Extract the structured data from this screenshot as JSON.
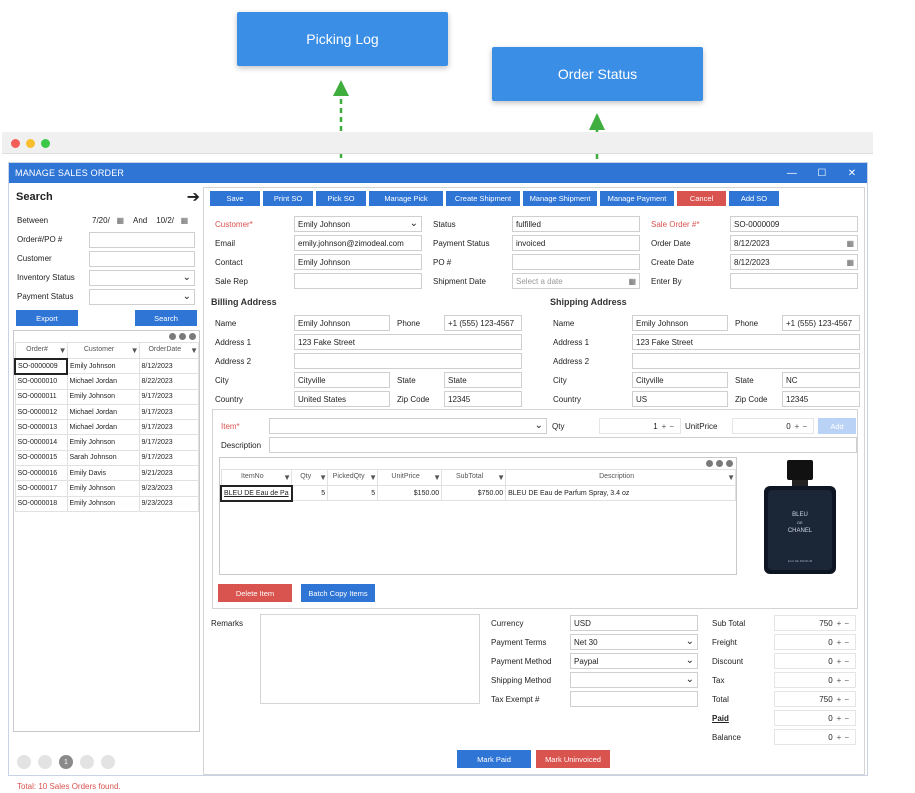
{
  "callouts": {
    "picking_log": "Picking Log",
    "order_status": "Order Status"
  },
  "window": {
    "title": "MANAGE SALES ORDER"
  },
  "search": {
    "title": "Search",
    "between_label": "Between",
    "date_from": "7/20/",
    "and_label": "And",
    "date_to": "10/2/",
    "order_po_label": "Order#/PO #",
    "customer_label": "Customer",
    "inventory_status_label": "Inventory Status",
    "payment_status_label": "Payment Status",
    "export_label": "Export",
    "search_label": "Search"
  },
  "order_grid": {
    "headers": [
      "Order#",
      "Customer",
      "OrderDate"
    ],
    "rows": [
      [
        "SO-0000009",
        "Emily Johnson",
        "8/12/2023"
      ],
      [
        "SO-0000010",
        "Michael Jordan",
        "8/22/2023"
      ],
      [
        "SO-0000011",
        "Emily Johnson",
        "9/17/2023"
      ],
      [
        "SO-0000012",
        "Michael Jordan",
        "9/17/2023"
      ],
      [
        "SO-0000013",
        "Michael Jordan",
        "9/17/2023"
      ],
      [
        "SO-0000014",
        "Emily Johnson",
        "9/17/2023"
      ],
      [
        "SO-0000015",
        "Sarah Johnson",
        "9/17/2023"
      ],
      [
        "SO-0000016",
        "Emily Davis",
        "9/21/2023"
      ],
      [
        "SO-0000017",
        "Emily Johnson",
        "9/23/2023"
      ],
      [
        "SO-0000018",
        "Emily Johnson",
        "9/23/2023"
      ]
    ]
  },
  "pager": {
    "current": "1"
  },
  "total_text": "Total: 10 Sales Orders found.",
  "toolbar": {
    "save": "Save",
    "print_so": "Print SO",
    "pick_so": "Pick SO",
    "manage_pick": "Manage Pick",
    "create_shipment": "Create Shipment",
    "manage_shipment": "Manage Shipment",
    "manage_payment": "Manage Payment",
    "cancel": "Cancel",
    "add_so": "Add SO"
  },
  "header": {
    "customer_label": "Customer*",
    "customer": "Emily Johnson",
    "email_label": "Email",
    "email": "emily.johnson@zimodeal.com",
    "contact_label": "Contact",
    "contact": "Emily Johnson",
    "sale_rep_label": "Sale Rep",
    "sale_rep": "",
    "status_label": "Status",
    "status": "fulfilled",
    "payment_status_label": "Payment Status",
    "payment_status": "invoiced",
    "po_label": "PO #",
    "po": "",
    "shipment_date_label": "Shipment Date",
    "shipment_date_placeholder": "Select a date",
    "sale_order_label": "Sale Order #*",
    "sale_order": "SO-0000009",
    "order_date_label": "Order Date",
    "order_date": "8/12/2023",
    "create_date_label": "Create Date",
    "create_date": "8/12/2023",
    "enter_by_label": "Enter By",
    "enter_by": ""
  },
  "billing": {
    "title": "Billing Address",
    "name_label": "Name",
    "name": "Emily Johnson",
    "phone_label": "Phone",
    "phone": "+1 (555) 123-4567",
    "address1_label": "Address 1",
    "address1": "123 Fake Street",
    "address2_label": "Address 2",
    "address2": "",
    "city_label": "City",
    "city": "Cityville",
    "state_label": "State",
    "state": "State",
    "country_label": "Country",
    "country": "United States",
    "zip_label": "Zip Code",
    "zip": "12345"
  },
  "shipping": {
    "title": "Shipping Address",
    "name_label": "Name",
    "name": "Emily Johnson",
    "phone_label": "Phone",
    "phone": "+1 (555) 123-4567",
    "address1_label": "Address 1",
    "address1": "123 Fake Street",
    "address2_label": "Address 2",
    "address2": "",
    "city_label": "City",
    "city": "Cityville",
    "state_label": "State",
    "state": "NC",
    "country_label": "Country",
    "country": "US",
    "zip_label": "Zip Code",
    "zip": "12345"
  },
  "item_entry": {
    "item_label": "Item*",
    "qty_label": "Qty",
    "qty": "1",
    "unit_price_label": "UnitPrice",
    "unit_price": "0",
    "add_label": "Add",
    "description_label": "Description"
  },
  "item_grid": {
    "headers": [
      "ItemNo",
      "Qty",
      "PickedQty",
      "UnitPrice",
      "SubTotal",
      "Description"
    ],
    "rows": [
      [
        "BLEU DE Eau de Pa",
        "5",
        "5",
        "$150.00",
        "$750.00",
        "BLEU DE Eau de Parfum Spray, 3.4 oz"
      ]
    ]
  },
  "product_image": {
    "brand_line1": "BLEU",
    "brand_line2": "DE",
    "brand_line3": "CHANEL",
    "sub": "EAU DE PARFUM"
  },
  "item_buttons": {
    "delete": "Delete Item",
    "batch_copy": "Batch Copy Items"
  },
  "remarks_label": "Remarks",
  "payment": {
    "currency_label": "Currency",
    "currency": "USD",
    "terms_label": "Payment Terms",
    "terms": "Net 30",
    "method_label": "Payment Method",
    "method": "Paypal",
    "shipping_method_label": "Shipping Method",
    "shipping_method": "",
    "tax_exempt_label": "Tax Exempt #",
    "tax_exempt": ""
  },
  "totals": {
    "sub_total_label": "Sub Total",
    "sub_total": "750",
    "freight_label": "Freight",
    "freight": "0",
    "discount_label": "Discount",
    "discount": "0",
    "tax_label": "Tax",
    "tax": "0",
    "total_label": "Total",
    "total": "750",
    "paid_label": "Paid",
    "paid": "0",
    "balance_label": "Balance",
    "balance": "0"
  },
  "footer_buttons": {
    "mark_paid": "Mark Paid",
    "mark_uninvoiced": "Mark Uninvoiced"
  },
  "colors": {
    "accent": "#2f75d6",
    "danger": "#d9534f",
    "callout": "#3a8ee6",
    "arrow": "#3fae3f"
  }
}
